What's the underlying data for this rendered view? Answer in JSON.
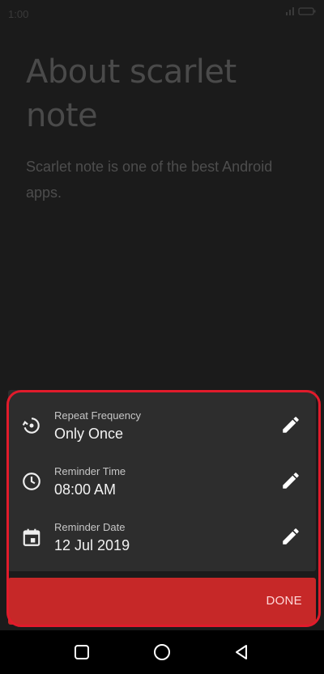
{
  "status_bar": {
    "time": "1:00"
  },
  "note": {
    "title": "About scarlet note",
    "body": "Scarlet note is one of the best Android apps."
  },
  "reminder_sheet": {
    "rows": [
      {
        "label": "Repeat Frequency",
        "value": "Only Once",
        "icon": "repeat-history-icon",
        "edit_icon": "pencil-icon"
      },
      {
        "label": "Reminder Time",
        "value": "08:00 AM",
        "icon": "clock-icon",
        "edit_icon": "pencil-icon"
      },
      {
        "label": "Reminder Date",
        "value": "12 Jul 2019",
        "icon": "calendar-icon",
        "edit_icon": "pencil-icon"
      }
    ],
    "done_label": "DONE"
  },
  "colors": {
    "accent": "#c62828",
    "sheet_background": "#2d2d2d",
    "highlight_outline": "#e11b2b"
  },
  "nav_icons": [
    "recent-apps-icon",
    "home-icon",
    "back-icon"
  ]
}
